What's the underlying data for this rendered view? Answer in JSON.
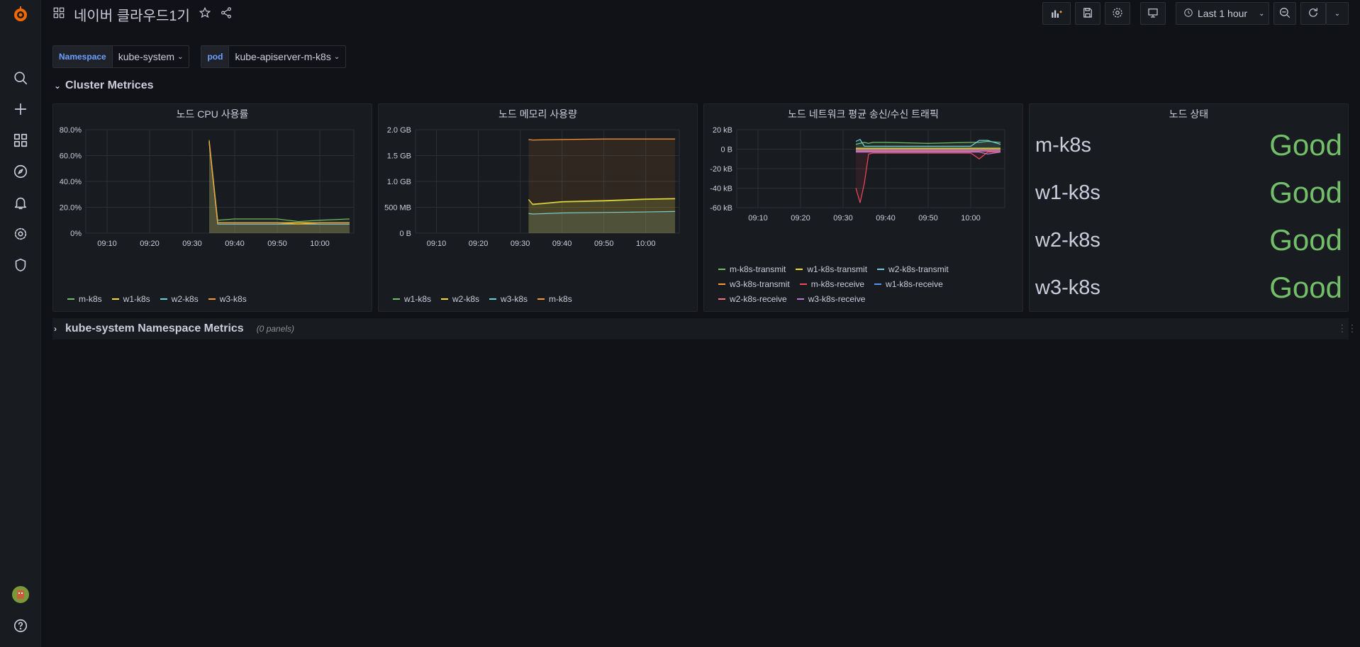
{
  "header": {
    "title": "네이버 클라우드1기",
    "time_range": "Last 1 hour"
  },
  "variables": [
    {
      "label": "Namespace",
      "value": "kube-system"
    },
    {
      "label": "pod",
      "value": "kube-apiserver-m-k8s"
    }
  ],
  "rows": {
    "cluster": {
      "title": "Cluster Metrices"
    },
    "namespace": {
      "title": "kube-system Namespace Metrics",
      "meta": "(0 panels)"
    }
  },
  "time_ticks": [
    "09:10",
    "09:20",
    "09:30",
    "09:40",
    "09:50",
    "10:00"
  ],
  "colors": {
    "green": "#73bf69",
    "yellow": "#fade2a",
    "teal": "#5794f2",
    "orange": "#ff9830",
    "red": "#f2495c",
    "blue": "#5794f2",
    "purple": "#b877d9",
    "pink": "#ff7383",
    "cyan": "#8ab8ff",
    "aqua": "#6ed0e0"
  },
  "panels": {
    "cpu": {
      "title": "노드 CPU 사용률",
      "y_ticks": [
        "80.0%",
        "60.0%",
        "40.0%",
        "20.0%",
        "0%"
      ],
      "legend": [
        "m-k8s",
        "w1-k8s",
        "w2-k8s",
        "w3-k8s"
      ]
    },
    "memory": {
      "title": "노드 메모리 사용량",
      "y_ticks": [
        "2.0 GB",
        "1.5 GB",
        "1.0 GB",
        "500 MB",
        "0 B"
      ],
      "legend": [
        "w1-k8s",
        "w2-k8s",
        "w3-k8s",
        "m-k8s"
      ]
    },
    "network": {
      "title": "노드 네트워크 평균 송신/수신 트래픽",
      "y_ticks": [
        "20 kB",
        "0 B",
        "-20 kB",
        "-40 kB",
        "-60 kB"
      ],
      "legend": [
        "m-k8s-transmit",
        "w1-k8s-transmit",
        "w2-k8s-transmit",
        "w3-k8s-transmit",
        "m-k8s-receive",
        "w1-k8s-receive",
        "w2-k8s-receive",
        "w3-k8s-receive"
      ]
    },
    "status": {
      "title": "노드 상태",
      "nodes": [
        {
          "name": "m-k8s",
          "value": "Good"
        },
        {
          "name": "w1-k8s",
          "value": "Good"
        },
        {
          "name": "w2-k8s",
          "value": "Good"
        },
        {
          "name": "w3-k8s",
          "value": "Good"
        }
      ]
    }
  },
  "chart_data": [
    {
      "type": "area",
      "title": "노드 CPU 사용률",
      "x": [
        "09:33",
        "09:34",
        "09:36",
        "09:40",
        "09:50",
        "09:55",
        "10:00",
        "10:07"
      ],
      "ylim": [
        0,
        80
      ],
      "series": [
        {
          "name": "m-k8s",
          "values": [
            null,
            72,
            10,
            11,
            11,
            9,
            10,
            11
          ]
        },
        {
          "name": "w1-k8s",
          "values": [
            null,
            71,
            8,
            8,
            8,
            8,
            8,
            8
          ]
        },
        {
          "name": "w2-k8s",
          "values": [
            null,
            70,
            7,
            7,
            7,
            7,
            7,
            7
          ]
        },
        {
          "name": "w3-k8s",
          "values": [
            null,
            70,
            8,
            8,
            8,
            7,
            8,
            8
          ]
        }
      ]
    },
    {
      "type": "area",
      "title": "노드 메모리 사용량",
      "x": [
        "09:32",
        "09:33",
        "09:40",
        "09:50",
        "10:00",
        "10:07"
      ],
      "ylim": [
        0,
        2.0
      ],
      "series": [
        {
          "name": "w1-k8s",
          "values": [
            0.65,
            0.55,
            0.6,
            0.62,
            0.65,
            0.66
          ]
        },
        {
          "name": "w2-k8s",
          "values": [
            0.65,
            0.56,
            0.61,
            0.63,
            0.66,
            0.67
          ]
        },
        {
          "name": "w3-k8s",
          "values": [
            0.38,
            0.37,
            0.39,
            0.4,
            0.41,
            0.42
          ]
        },
        {
          "name": "m-k8s",
          "values": [
            1.81,
            1.8,
            1.81,
            1.82,
            1.82,
            1.82
          ]
        }
      ]
    },
    {
      "type": "line",
      "title": "노드 네트워크 평균 송신/수신 트래픽",
      "x": [
        "09:33",
        "09:34",
        "09:35",
        "09:36",
        "09:37",
        "09:40",
        "09:50",
        "10:00",
        "10:02",
        "10:04",
        "10:07"
      ],
      "ylim": [
        -60,
        20
      ],
      "series": [
        {
          "name": "m-k8s-transmit",
          "values": [
            5,
            6,
            7,
            6,
            7,
            7,
            6,
            7,
            7,
            8,
            7
          ]
        },
        {
          "name": "w1-k8s-transmit",
          "values": [
            1,
            1,
            1,
            1,
            1,
            1,
            1,
            1,
            1,
            1,
            1
          ]
        },
        {
          "name": "w2-k8s-transmit",
          "values": [
            8,
            10,
            3,
            3,
            3,
            3,
            3,
            3,
            9,
            9,
            5
          ]
        },
        {
          "name": "w3-k8s-transmit",
          "values": [
            0,
            0,
            0,
            0,
            0,
            0,
            0,
            0,
            0,
            0,
            0
          ]
        },
        {
          "name": "m-k8s-receive",
          "values": [
            -40,
            -55,
            -35,
            -5,
            -4,
            -4,
            -4,
            -4,
            -10,
            -3,
            -3
          ]
        },
        {
          "name": "w1-k8s-receive",
          "values": [
            -1,
            -1,
            -1,
            -1,
            -1,
            -1,
            -1,
            -1,
            -1,
            -1,
            -1
          ]
        },
        {
          "name": "w2-k8s-receive",
          "values": [
            -2,
            -2,
            -2,
            -2,
            -2,
            -2,
            -2,
            -2,
            -2,
            -2,
            -2
          ]
        },
        {
          "name": "w3-k8s-receive",
          "values": [
            -3,
            -3,
            -3,
            -3,
            -3,
            -3,
            -3,
            -3,
            -3,
            -5,
            -3
          ]
        }
      ]
    }
  ]
}
